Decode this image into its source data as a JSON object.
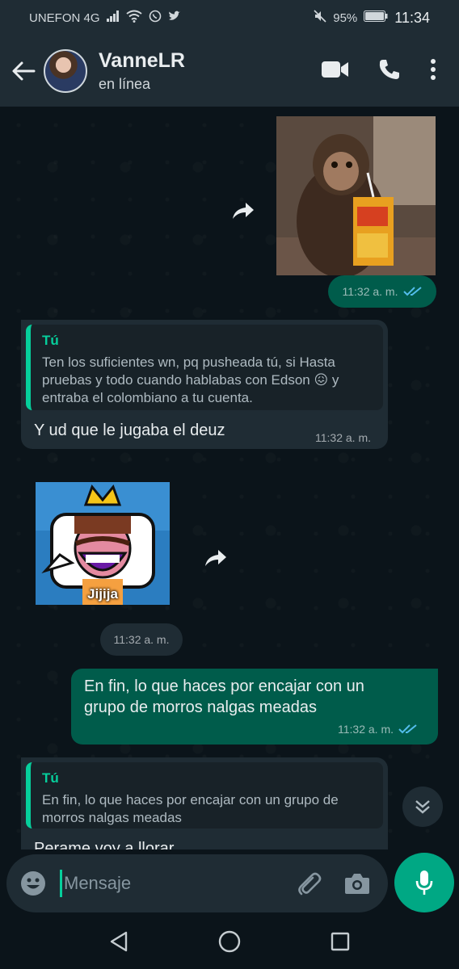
{
  "status_bar": {
    "carrier": "UNEFON 4G",
    "battery": "95%",
    "time": "11:34"
  },
  "header": {
    "contact_name": "VanneLR",
    "status": "en línea"
  },
  "messages": [
    {
      "type": "image-out",
      "time": "11:32 a. m.",
      "ticks": "read"
    },
    {
      "type": "text-in",
      "quote_author": "Tú",
      "quote_text": "Ten los suficientes wn, pq pusheada tú, si Hasta pruebas y todo cuando hablabas con Edson 😖 y entraba el colombiano a tu cuenta.",
      "text": "Y ud que le jugaba el deuz",
      "time": "11:32 a. m."
    },
    {
      "type": "sticker-in",
      "sticker_caption": "Jijija",
      "time": "11:32 a. m."
    },
    {
      "type": "text-out",
      "text": "En fin, lo que haces por encajar con un grupo de morros nalgas meadas",
      "time": "11:32 a. m.",
      "ticks": "read"
    },
    {
      "type": "text-in",
      "quote_author": "Tú",
      "quote_text": "En fin, lo que haces por encajar con un grupo de morros nalgas meadas",
      "text": "Perame voy a llorar"
    }
  ],
  "input": {
    "placeholder": "Mensaje"
  },
  "colors": {
    "accent": "#00a884",
    "outgoing_bubble": "#005c4b",
    "incoming_bubble": "#1f2c34",
    "read_ticks": "#53bdeb"
  }
}
